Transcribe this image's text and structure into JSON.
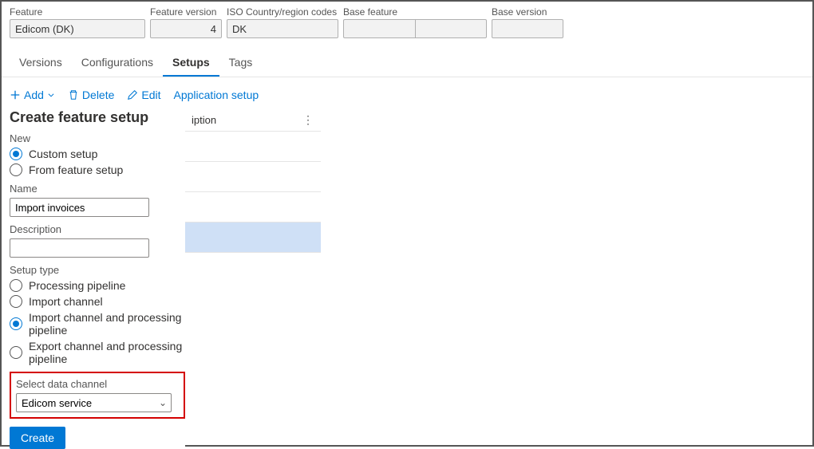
{
  "header": {
    "feature_label": "Feature",
    "feature_value": "Edicom (DK)",
    "version_label": "Feature version",
    "version_value": "4",
    "iso_label": "ISO Country/region codes",
    "iso_value": "DK",
    "base_feature_label": "Base feature",
    "base_feature_value": "",
    "base_version_label": "Base version",
    "base_version_value": ""
  },
  "tabs": {
    "versions": "Versions",
    "configurations": "Configurations",
    "setups": "Setups",
    "tags": "Tags"
  },
  "toolbar": {
    "add": "Add",
    "delete": "Delete",
    "edit": "Edit",
    "app_setup": "Application setup"
  },
  "panel": {
    "title": "Create feature setup",
    "new_label": "New",
    "custom_setup": "Custom setup",
    "from_feature": "From feature setup",
    "name_label": "Name",
    "name_value": "Import invoices",
    "description_label": "Description",
    "description_value": "",
    "setup_type_label": "Setup type",
    "processing_pipeline": "Processing pipeline",
    "import_channel": "Import channel",
    "import_channel_pp": "Import channel and processing pipeline",
    "export_channel_pp": "Export channel and processing pipeline",
    "select_channel_label": "Select data channel",
    "select_channel_value": "Edicom service",
    "create_label": "Create"
  },
  "grid": {
    "header_col": "iption"
  }
}
